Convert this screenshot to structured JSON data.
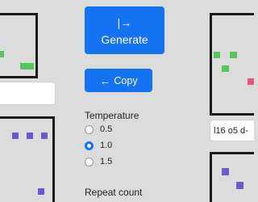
{
  "buttons": {
    "generate": {
      "icon": "|→",
      "label": "Generate"
    },
    "copy": {
      "icon": "←",
      "label": "Copy"
    }
  },
  "temperature": {
    "label": "Temperature",
    "options": [
      "0.5",
      "1.0",
      "1.5"
    ],
    "selected": "1.0"
  },
  "repeat_count": {
    "label": "Repeat count"
  },
  "right_field": {
    "value": "l16 o5 d-"
  },
  "colors": {
    "accent": "#1473f0",
    "green": "#57c65a",
    "purple": "#6a5acd",
    "pink": "#e8517a",
    "border": "#1a1a1a"
  }
}
